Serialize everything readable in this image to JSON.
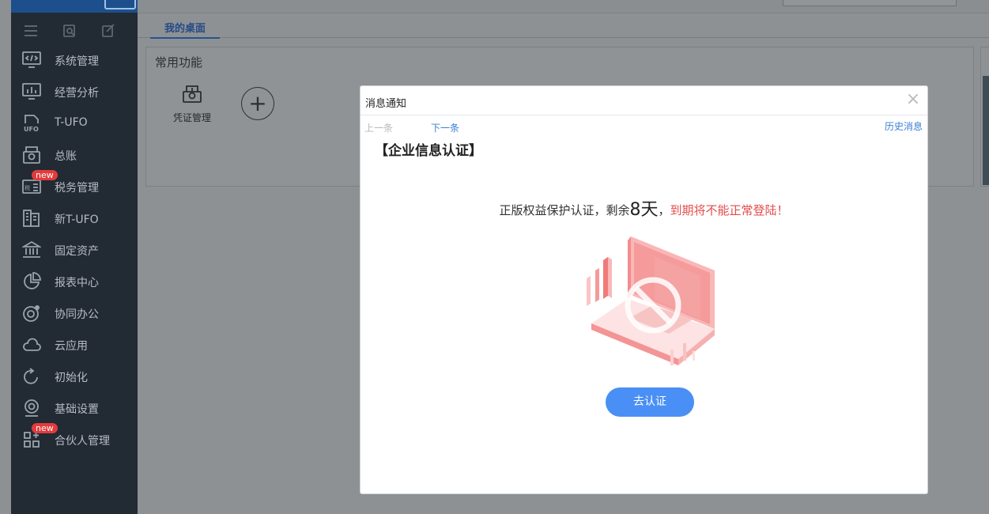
{
  "sidebar": {
    "items": [
      {
        "label": "系统管理",
        "icon": "code-monitor-icon",
        "badge": ""
      },
      {
        "label": "经营分析",
        "icon": "chart-monitor-icon",
        "badge": ""
      },
      {
        "label": "T-UFO",
        "icon": "ufo-doc-icon",
        "badge": ""
      },
      {
        "label": "总账",
        "icon": "ledger-icon",
        "badge": ""
      },
      {
        "label": "税务管理",
        "icon": "tax-icon",
        "badge": "new"
      },
      {
        "label": "新T-UFO",
        "icon": "building-icon",
        "badge": ""
      },
      {
        "label": "固定资产",
        "icon": "bank-icon",
        "badge": ""
      },
      {
        "label": "报表中心",
        "icon": "pie-icon",
        "badge": ""
      },
      {
        "label": "协同办公",
        "icon": "collab-icon",
        "badge": ""
      },
      {
        "label": "云应用",
        "icon": "cloud-icon",
        "badge": ""
      },
      {
        "label": "初始化",
        "icon": "refresh-icon",
        "badge": ""
      },
      {
        "label": "基础设置",
        "icon": "webcam-icon",
        "badge": ""
      },
      {
        "label": "合伙人管理",
        "icon": "grid-plus-icon",
        "badge": "new"
      }
    ]
  },
  "tabs": {
    "active": "我的桌面"
  },
  "common_functions": {
    "title": "常用功能",
    "items": [
      {
        "label": "凭证管理",
        "icon": "voucher-icon"
      }
    ],
    "add_label": "+"
  },
  "modal": {
    "title": "消息通知",
    "close": "×",
    "prev": "上一条",
    "next": "下一条",
    "history": "历史消息",
    "info_title": "【企业信息认证】",
    "message_prefix": "正版权益保护认证，剩余",
    "days": "8天",
    "message_sep": "，",
    "warning": "到期将不能正常登陆！",
    "button": "去认证",
    "accent_color": "#4a8ff5",
    "warning_color": "#e34b4b"
  }
}
